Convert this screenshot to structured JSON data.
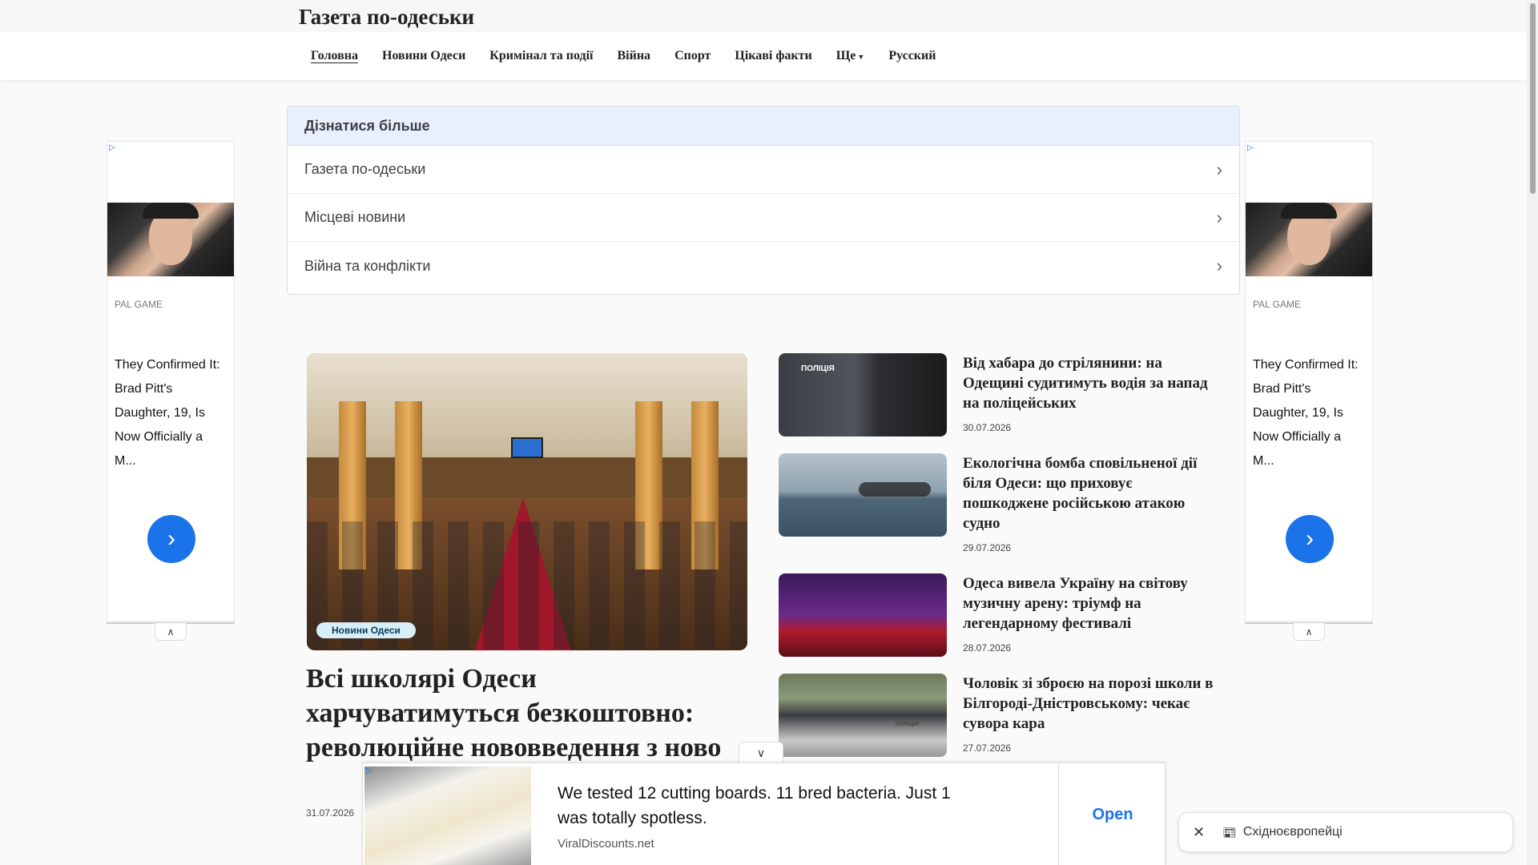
{
  "site": {
    "title": "Газета по-одеськи"
  },
  "nav": {
    "items": [
      "Головна",
      "Новини Одеси",
      "Кримінал та події",
      "Війна",
      "Спорт",
      "Цікаві факти",
      "Ще",
      "Русский"
    ]
  },
  "learn_more": {
    "heading": "Дізнатися більше",
    "items": [
      "Газета по-одеськи",
      "Місцеві новини",
      "Війна та конфлікти"
    ]
  },
  "side_ad": {
    "brand": "PAL GAME",
    "headline": "They Confirmed It: Brad Pitt's Daughter, 19, Is Now Officially a M...",
    "go_icon": "chevron-right-icon"
  },
  "feature": {
    "tag": "Новини Одеси",
    "title": "Всі школярі Одеси харчуватимуться безкоштовно: революційне нововведення з ново",
    "date": "31.07.2026"
  },
  "news": [
    {
      "title": "Від хабара до стрілянини: на Одещині судитимуть водія за напад на поліцейських",
      "date": "30.07.2026",
      "image_text": "ПОЛІЦІЯ"
    },
    {
      "title": "Екологічна бомба сповільненої дії біля Одеси: що приховує пошкоджене російською атакою судно",
      "date": "29.07.2026"
    },
    {
      "title": "Одеса вивела Україну на світову музичну арену: тріумф на легендарному фестивалі",
      "date": "28.07.2026"
    },
    {
      "title": "Чоловік зі зброєю на порозі школи в Білгороді-Дністровському: чекає сувора кара",
      "date": "27.07.2026",
      "image_text": "ПОЛІЦІЯ"
    }
  ],
  "bottom_ad": {
    "text": "We tested 12 cutting boards. 11 bred bacteria. Just 1 was totally spotless.",
    "source": "ViralDiscounts.net",
    "cta": "Open"
  },
  "chip": {
    "label": "Східноєвропейці",
    "icon": "newspaper-icon"
  },
  "colors": {
    "accent": "#1a73e8",
    "learn_header_bg": "#e8f0fe",
    "tag_bg": "#d8eef8"
  }
}
